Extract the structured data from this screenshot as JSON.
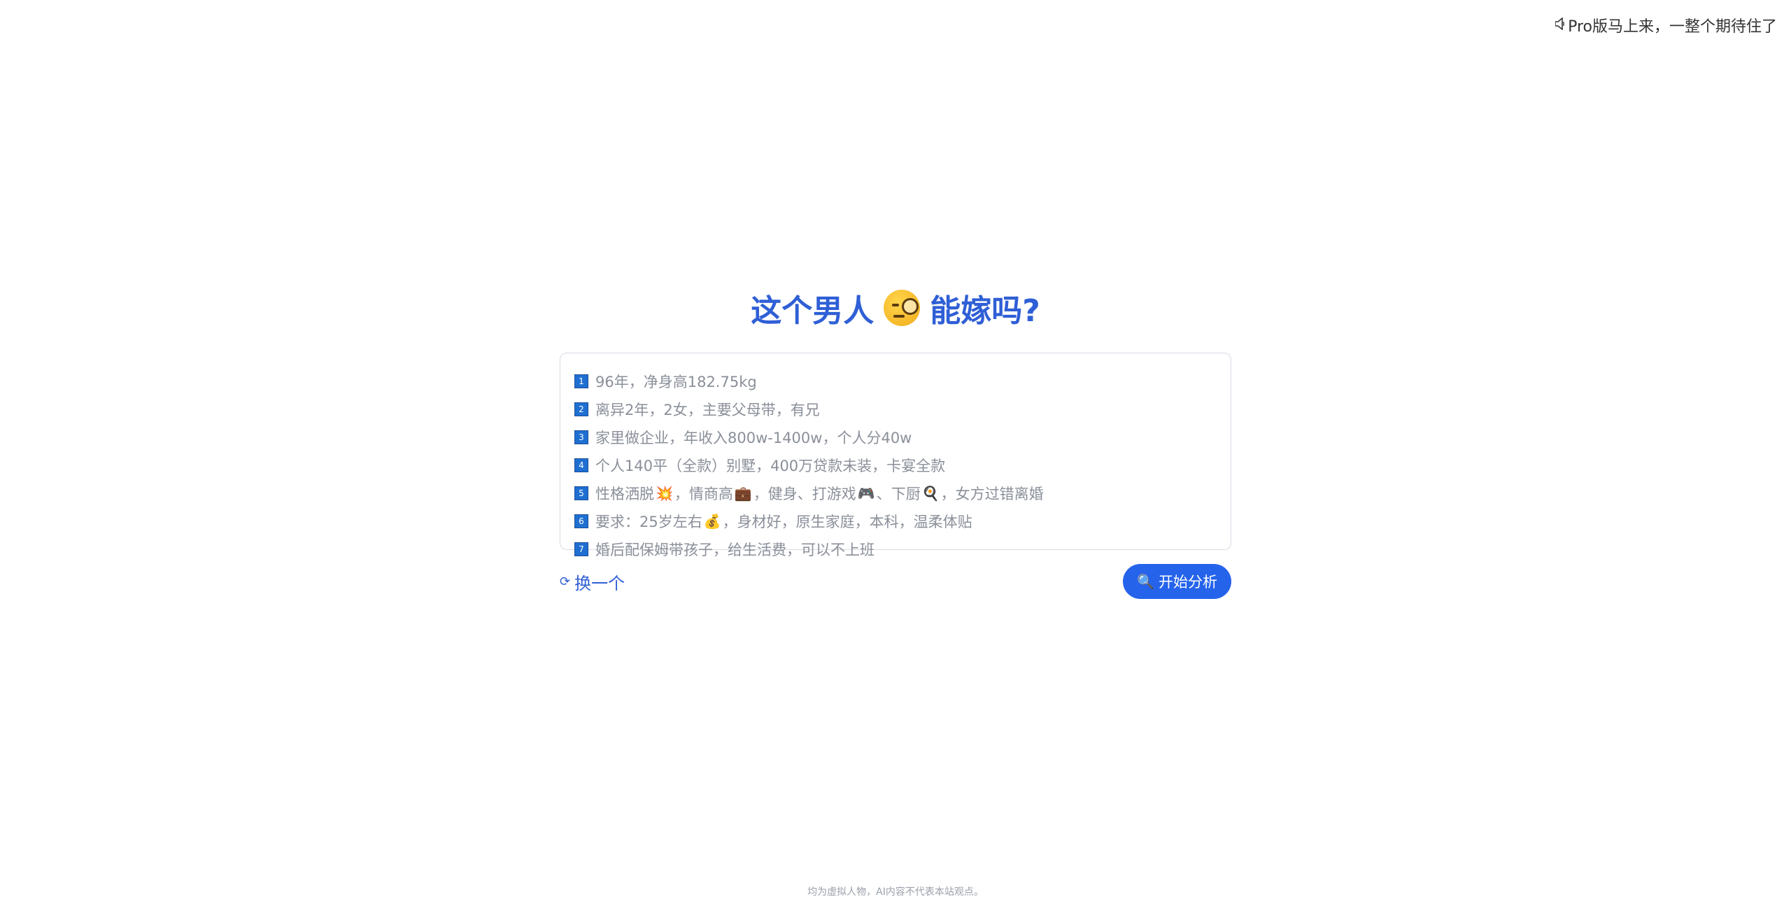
{
  "announcement": {
    "icon": "speaker-icon",
    "text": "Pro版马上来，一整个期待住了"
  },
  "title": {
    "part1": "这个男人",
    "emoji": "face-with-monocle-icon",
    "part2": "能嫁吗?"
  },
  "profile": {
    "items": [
      {
        "num": "1",
        "text": "96年，净身高182.75kg"
      },
      {
        "num": "2",
        "text": "离异2年，2女，主要父母带，有兄"
      },
      {
        "num": "3",
        "text": "家里做企业，年收入800w-1400w，个人分40w"
      },
      {
        "num": "4",
        "text": "个人140平（全款）别墅，400万贷款未装，卡宴全款"
      },
      {
        "num": "5",
        "text_a": "性格洒脱",
        "emoji_a": "💥",
        "text_b": "，情商高",
        "emoji_b": "💼",
        "text_c": "，健身、打游戏",
        "emoji_c": "🎮",
        "text_d": "、下厨",
        "emoji_d": "🍳",
        "text_e": "，女方过错离婚"
      },
      {
        "num": "6",
        "text_a": "要求：25岁左右",
        "emoji_a": "💰",
        "text_b": "，身材好，原生家庭，本科，温柔体贴"
      },
      {
        "num": "7",
        "text": "婚后配保姆带孩子，给生活费，可以不上班"
      }
    ]
  },
  "actions": {
    "swap_icon": "⟳",
    "swap_label": "换一个",
    "analyze_icon": "🔍",
    "analyze_label": "开始分析"
  },
  "footer": {
    "note": "均为虚拟人物，AI内容不代表本站观点。"
  },
  "colors": {
    "accent": "#2f5fd6",
    "button": "#2563eb",
    "badge": "#1f6fd1"
  }
}
